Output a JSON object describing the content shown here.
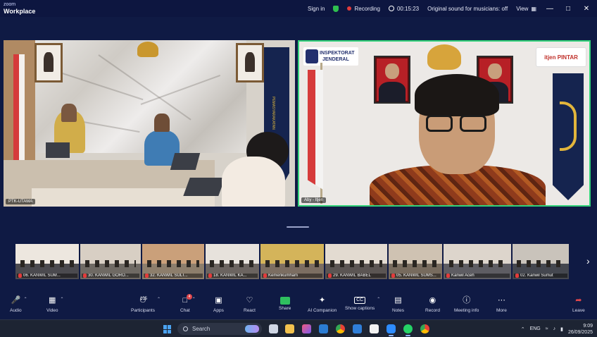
{
  "window": {
    "brand_line1": "zoom",
    "brand_line2": "Workplace",
    "sign_in": "Sign in",
    "recording_label": "Recording",
    "timer": "00:15:23",
    "audio_status": "Original sound for musicians: off",
    "view_label": "View",
    "controls": [
      "—",
      "□",
      "✕"
    ]
  },
  "main_video": {
    "left_name": "PTK-UTAMA",
    "right_name": "Aby - Itjen",
    "right_logo_line1": "INSPEKTORAT",
    "right_logo_line2": "JENDERAL",
    "right_brand": "itjen PINTAR",
    "left_banner_text": "PEMASYARAKATAN",
    "speaker_border_color": "#32d27a"
  },
  "thumbnails": [
    {
      "label": "06. KANWIL SUM...",
      "muted": true
    },
    {
      "label": "30. KANWIL GORO...",
      "muted": true
    },
    {
      "label": "32. KANWIL SULT...",
      "muted": true
    },
    {
      "label": "18. KANWIL KA...",
      "muted": true
    },
    {
      "label": "Kemenkumham",
      "muted": true
    },
    {
      "label": "29. KANWIL BABEL",
      "muted": true
    },
    {
      "label": "05. KANWIL SUMS...",
      "muted": true
    },
    {
      "label": "Kanwil Aceh",
      "muted": true
    },
    {
      "label": "02. Kanwil Sumut",
      "muted": true
    }
  ],
  "toolbar": {
    "audio": "Audio",
    "video": "Video",
    "participants": "Participants",
    "participants_count": "105",
    "chat": "Chat",
    "chat_badge": "4",
    "apps": "Apps",
    "react": "React",
    "share": "Share",
    "ai_companion": "AI Companion",
    "captions": "Show captions",
    "notes": "Notes",
    "record": "Record",
    "meeting_info": "Meeting info",
    "more": "More",
    "leave": "Leave"
  },
  "taskbar": {
    "search_placeholder": "Search",
    "lang": "ENG",
    "time": "9:09",
    "date": "26/09/2025"
  }
}
